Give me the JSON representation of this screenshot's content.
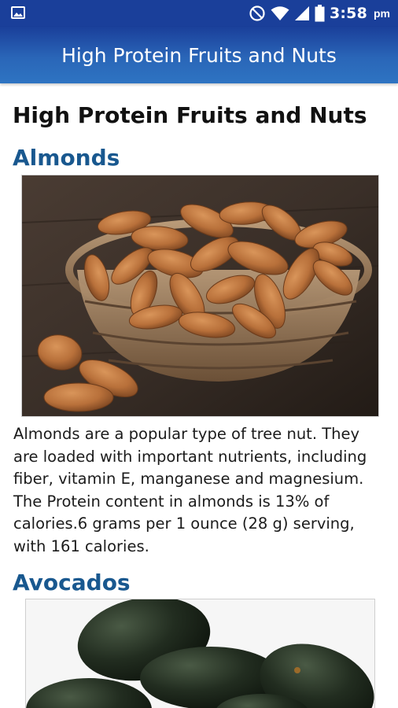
{
  "status_bar": {
    "time": "3:58",
    "ampm": "pm",
    "icons": [
      "image-notification-icon",
      "do-not-disturb-icon",
      "wifi-icon",
      "signal-icon",
      "battery-icon"
    ]
  },
  "app_bar": {
    "title": "High Protein Fruits and Nuts",
    "colors": {
      "top": "#1a3f9a",
      "bottom": "#2e74c2"
    }
  },
  "article": {
    "heading": "High Protein Fruits and Nuts",
    "sections": [
      {
        "title": "Almonds",
        "image": "almonds-in-wicker-basket",
        "text": "Almonds are a popular type of tree nut. They are loaded with important nutrients, including fiber, vitamin E, manganese and magnesium. The Protein content in almonds is 13% of calories.6 grams per 1 ounce (28 g) serving, with 161 calories."
      },
      {
        "title": "Avocados",
        "image": "avocados-pile"
      }
    ],
    "heading_color": "#19588f"
  }
}
